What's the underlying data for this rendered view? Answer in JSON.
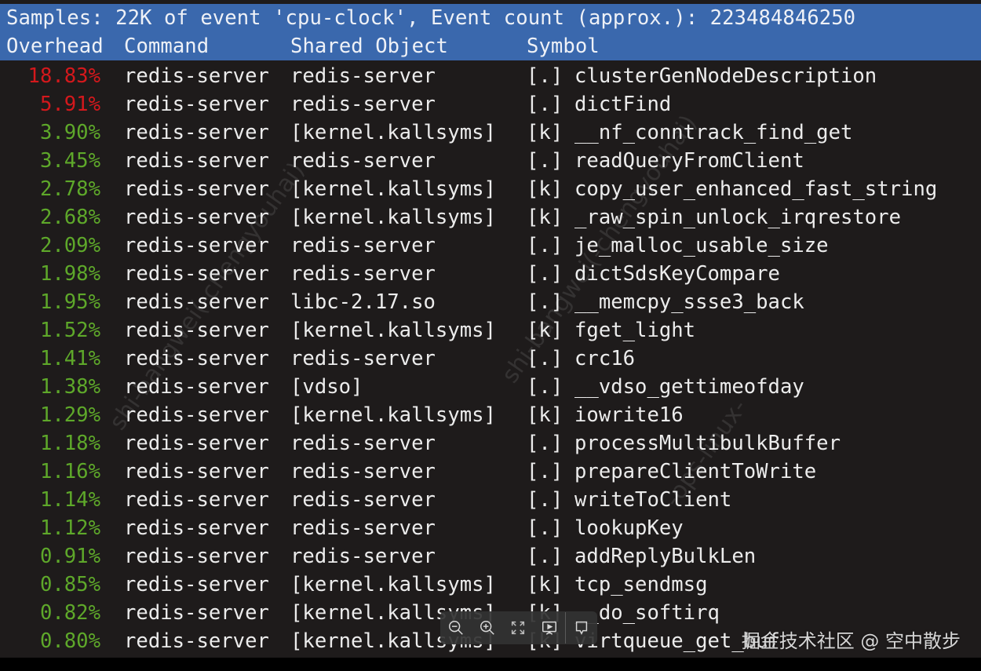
{
  "header": {
    "summary": "Samples: 22K of event 'cpu-clock', Event count (approx.): 223484846250",
    "columns": {
      "overhead": "Overhead",
      "command": "Command",
      "shared_object": "Shared Object",
      "symbol": "Symbol"
    }
  },
  "colors": {
    "header_bg": "#3a68ad",
    "terminal_bg": "#1e1b1b",
    "hot": "#d4181c",
    "warm": "#5ea82a",
    "text": "#ececec"
  },
  "rows": [
    {
      "overhead": "18.83%",
      "level": "hot",
      "command": "redis-server",
      "shared_object": "redis-server",
      "tag": "[.]",
      "symbol": "clusterGenNodeDescription"
    },
    {
      "overhead": "5.91%",
      "level": "hot",
      "command": "redis-server",
      "shared_object": "redis-server",
      "tag": "[.]",
      "symbol": "dictFind"
    },
    {
      "overhead": "3.90%",
      "level": "warm",
      "command": "redis-server",
      "shared_object": "[kernel.kallsyms]",
      "tag": "[k]",
      "symbol": "__nf_conntrack_find_get"
    },
    {
      "overhead": "3.45%",
      "level": "warm",
      "command": "redis-server",
      "shared_object": "redis-server",
      "tag": "[.]",
      "symbol": "readQueryFromClient"
    },
    {
      "overhead": "2.78%",
      "level": "warm",
      "command": "redis-server",
      "shared_object": "[kernel.kallsyms]",
      "tag": "[k]",
      "symbol": "copy_user_enhanced_fast_string"
    },
    {
      "overhead": "2.68%",
      "level": "warm",
      "command": "redis-server",
      "shared_object": "[kernel.kallsyms]",
      "tag": "[k]",
      "symbol": "_raw_spin_unlock_irqrestore"
    },
    {
      "overhead": "2.09%",
      "level": "warm",
      "command": "redis-server",
      "shared_object": "redis-server",
      "tag": "[.]",
      "symbol": "je_malloc_usable_size"
    },
    {
      "overhead": "1.98%",
      "level": "warm",
      "command": "redis-server",
      "shared_object": "redis-server",
      "tag": "[.]",
      "symbol": "dictSdsKeyCompare"
    },
    {
      "overhead": "1.95%",
      "level": "warm",
      "command": "redis-server",
      "shared_object": "libc-2.17.so",
      "tag": "[.]",
      "symbol": "__memcpy_ssse3_back"
    },
    {
      "overhead": "1.52%",
      "level": "warm",
      "command": "redis-server",
      "shared_object": "[kernel.kallsyms]",
      "tag": "[k]",
      "symbol": "fget_light"
    },
    {
      "overhead": "1.41%",
      "level": "warm",
      "command": "redis-server",
      "shared_object": "redis-server",
      "tag": "[.]",
      "symbol": "crc16"
    },
    {
      "overhead": "1.38%",
      "level": "warm",
      "command": "redis-server",
      "shared_object": "[vdso]",
      "tag": "[.]",
      "symbol": "__vdso_gettimeofday"
    },
    {
      "overhead": "1.29%",
      "level": "warm",
      "command": "redis-server",
      "shared_object": "[kernel.kallsyms]",
      "tag": "[k]",
      "symbol": "iowrite16"
    },
    {
      "overhead": "1.18%",
      "level": "warm",
      "command": "redis-server",
      "shared_object": "redis-server",
      "tag": "[.]",
      "symbol": "processMultibulkBuffer"
    },
    {
      "overhead": "1.16%",
      "level": "warm",
      "command": "redis-server",
      "shared_object": "redis-server",
      "tag": "[.]",
      "symbol": "prepareClientToWrite"
    },
    {
      "overhead": "1.14%",
      "level": "warm",
      "command": "redis-server",
      "shared_object": "redis-server",
      "tag": "[.]",
      "symbol": "writeToClient"
    },
    {
      "overhead": "1.12%",
      "level": "warm",
      "command": "redis-server",
      "shared_object": "redis-server",
      "tag": "[.]",
      "symbol": "lookupKey"
    },
    {
      "overhead": "0.91%",
      "level": "warm",
      "command": "redis-server",
      "shared_object": "redis-server",
      "tag": "[.]",
      "symbol": "addReplyBulkLen"
    },
    {
      "overhead": "0.85%",
      "level": "warm",
      "command": "redis-server",
      "shared_object": "[kernel.kallsyms]",
      "tag": "[k]",
      "symbol": "tcp_sendmsg"
    },
    {
      "overhead": "0.82%",
      "level": "warm",
      "command": "redis-server",
      "shared_object": "[kernel.kallsyms]",
      "tag": "[k]",
      "symbol": "__do_softirq"
    },
    {
      "overhead": "0.80%",
      "level": "warm",
      "command": "redis-server",
      "shared_object": "[kernel.kallsyms]",
      "tag": "[k]",
      "symbol": "virtqueue_get_buf"
    }
  ],
  "toolbar": {
    "items": [
      {
        "icon": "zoom-out-icon",
        "label": "Zoom out"
      },
      {
        "icon": "zoom-in-icon",
        "label": "Zoom in"
      },
      {
        "icon": "fullscreen-icon",
        "label": "Fit"
      },
      {
        "icon": "slideshow-icon",
        "label": "Present"
      },
      {
        "icon": "comment-icon",
        "label": "Comment"
      }
    ]
  },
  "credit": "掘金技术社区 @ 空中散步",
  "watermarks": [
    "shi-bangwei(-chengyouhai)",
    "-ops-linux-"
  ]
}
